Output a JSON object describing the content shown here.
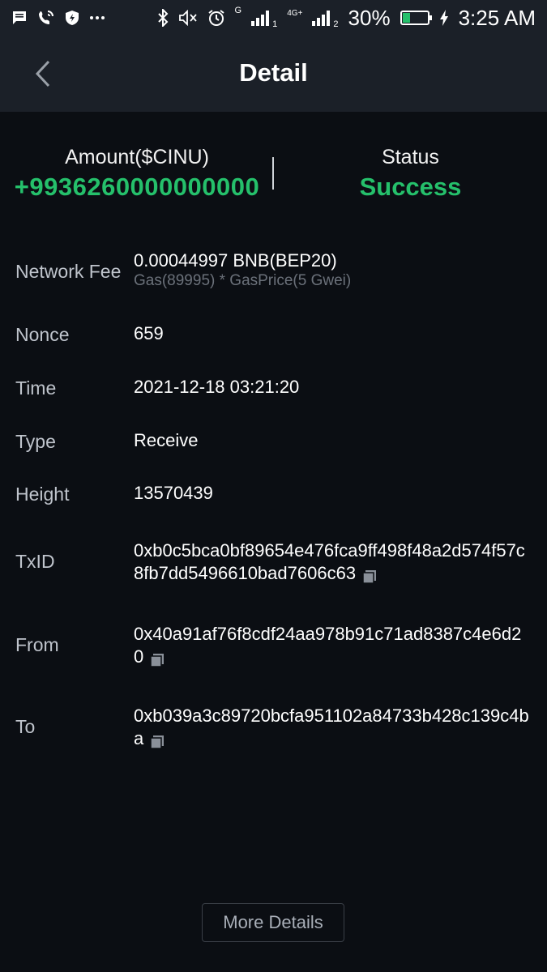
{
  "status_bar": {
    "battery": "30%",
    "time": "3:25 AM",
    "network_g": "G",
    "network_4g": "4G+",
    "sim1": "1",
    "sim2": "2"
  },
  "header": {
    "title": "Detail"
  },
  "summary": {
    "amount_label": "Amount($CINU)",
    "amount_value": "+9936260000000000",
    "status_label": "Status",
    "status_value": "Success"
  },
  "details": {
    "network_fee": {
      "label": "Network Fee",
      "value": "0.00044997 BNB(BEP20)",
      "sub": "Gas(89995) * GasPrice(5 Gwei)"
    },
    "nonce": {
      "label": "Nonce",
      "value": "659"
    },
    "time": {
      "label": "Time",
      "value": "2021-12-18 03:21:20"
    },
    "type": {
      "label": "Type",
      "value": "Receive"
    },
    "height": {
      "label": "Height",
      "value": "13570439"
    },
    "txid": {
      "label": "TxID",
      "value": "0xb0c5bca0bf89654e476fca9ff498f48a2d574f57c8fb7dd5496610bad7606c63"
    },
    "from": {
      "label": "From",
      "value": "0x40a91af76f8cdf24aa978b91c71ad8387c4e6d20"
    },
    "to": {
      "label": "To",
      "value": "0xb039a3c89720bcfa951102a84733b428c139c4ba"
    }
  },
  "more_button": {
    "label": "More Details"
  },
  "colors": {
    "accent_green": "#25c06b",
    "background": "#0b0e13",
    "header_bg": "#1b2028"
  },
  "icons": [
    "message-icon",
    "wifi-calling-icon",
    "shield-icon",
    "bluetooth-icon",
    "mute-icon",
    "alarm-icon",
    "copy-icon",
    "back-arrow-icon"
  ]
}
